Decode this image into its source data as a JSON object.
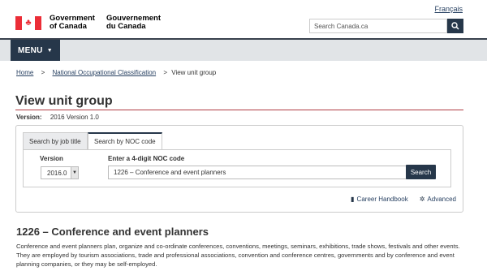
{
  "header": {
    "language_link": "Français",
    "signature": {
      "en_line1": "Government",
      "en_line2": "of Canada",
      "fr_line1": "Gouvernement",
      "fr_line2": "du Canada"
    },
    "search_placeholder": "Search Canada.ca",
    "menu_label": "MENU"
  },
  "breadcrumb": {
    "items": [
      "Home",
      "National Occupational Classification"
    ],
    "current": "View unit group",
    "separator": ">"
  },
  "page": {
    "title": "View unit group",
    "version_label": "Version:",
    "version_value": "2016 Version 1.0"
  },
  "search_panel": {
    "tabs": [
      "Search by job title",
      "Search by NOC code"
    ],
    "active_tab": 1,
    "version_label": "Version",
    "version_selected": "2016.0",
    "noc_label": "Enter a 4-digit NOC code",
    "noc_value": "1226 – Conference and event planners",
    "search_button": "Search",
    "links": {
      "career_handbook": "Career Handbook",
      "advanced": "Advanced"
    }
  },
  "unit_group": {
    "heading": "1226 – Conference and event planners",
    "description": "Conference and event planners plan, organize and co-ordinate conferences, conventions, meetings, seminars, exhibitions, trade shows, festivals and other events. They are employed by tourism associations, trade and professional associations, convention and conference centres, governments and by conference and event planning companies, or they may be self-employed."
  },
  "colors": {
    "brand_dark": "#26374a",
    "link": "#284162",
    "flag_red": "#eb2d37",
    "title_rule": "#af3c43"
  }
}
